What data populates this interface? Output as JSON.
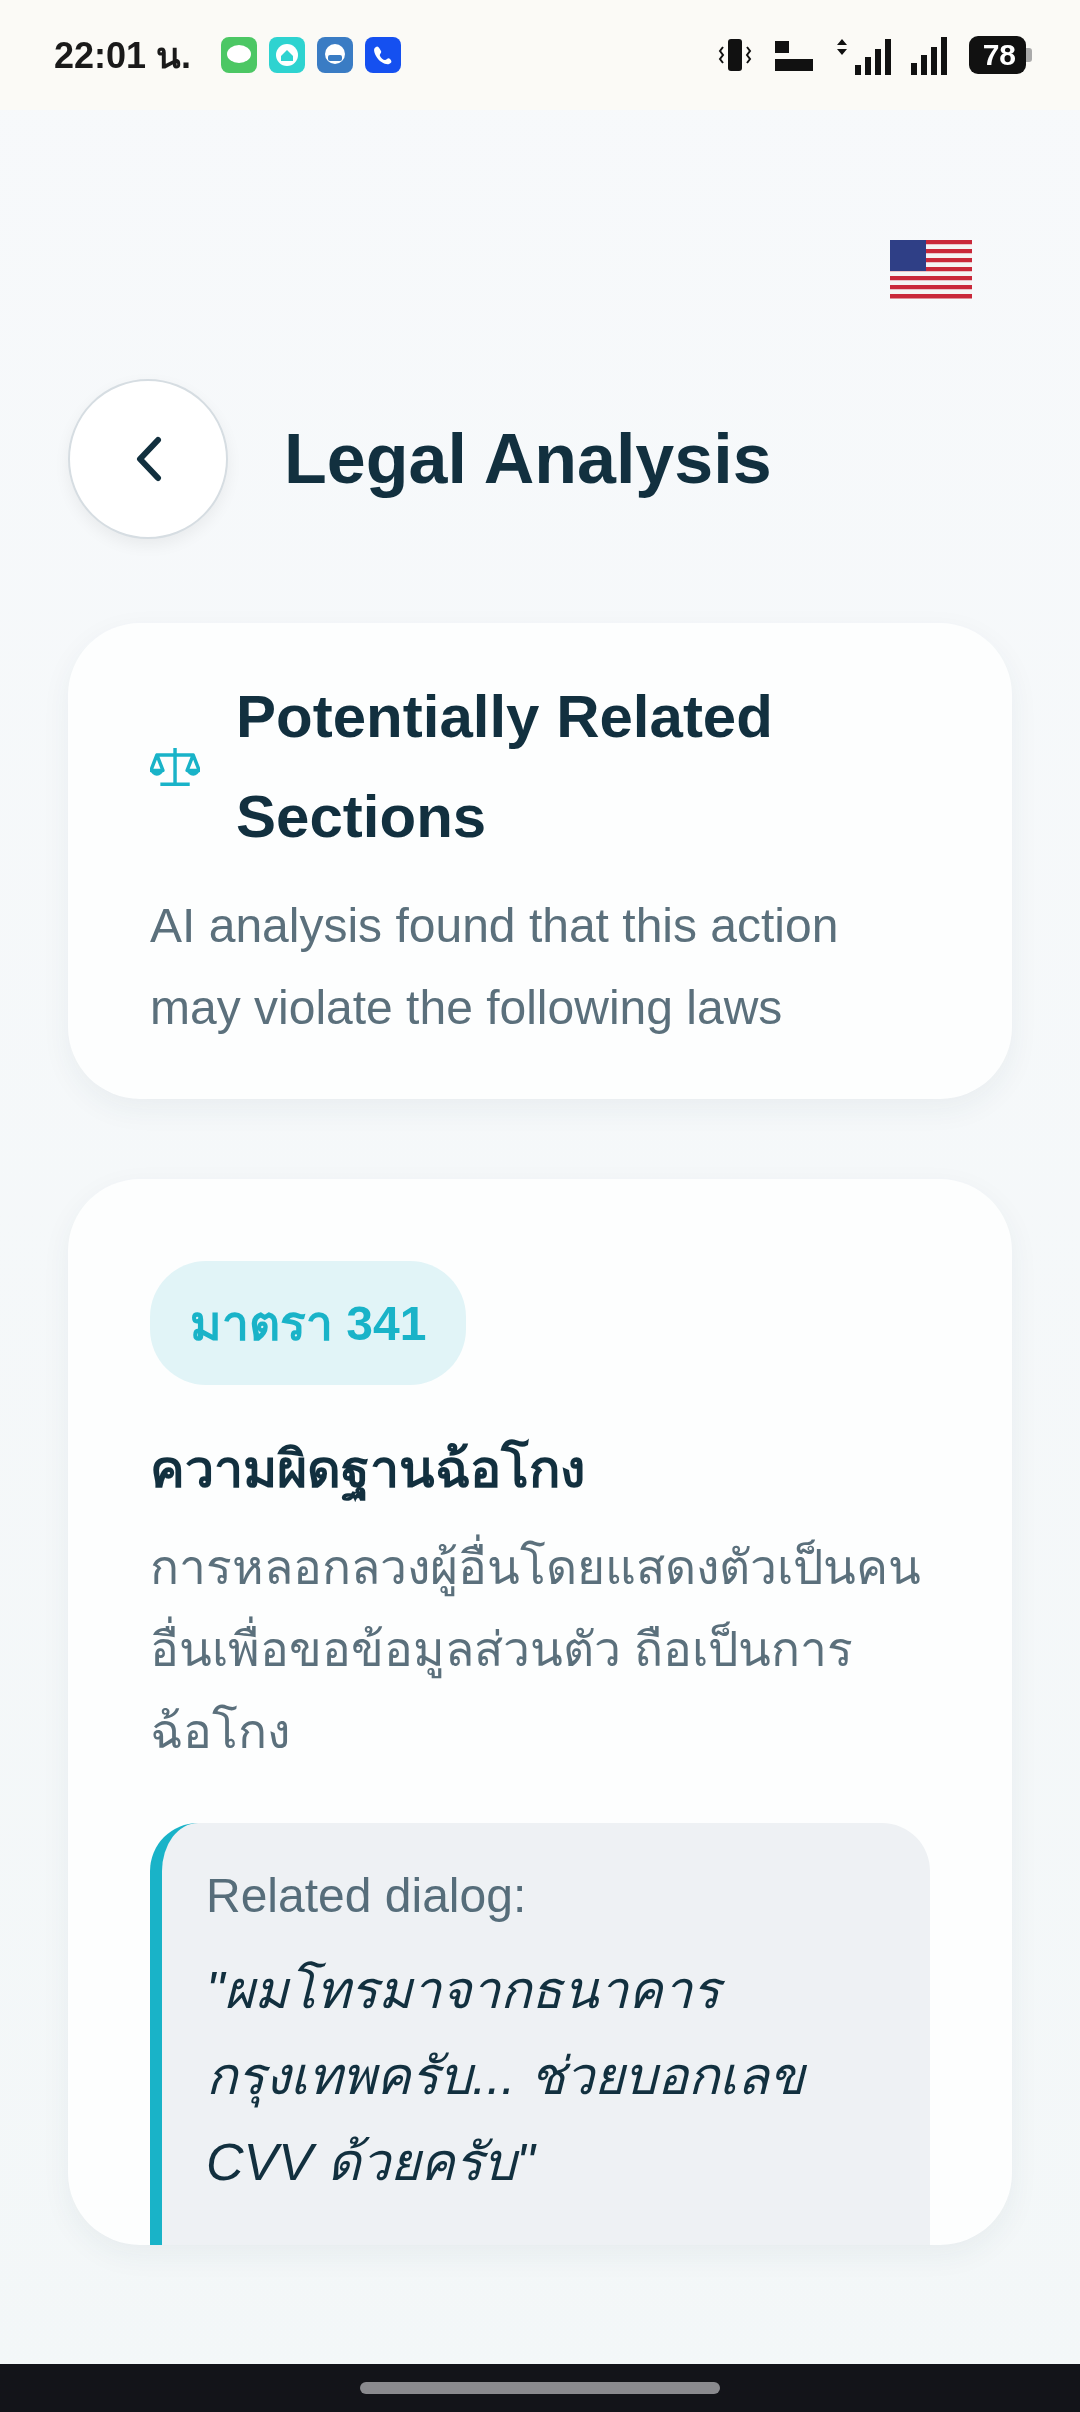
{
  "status_bar": {
    "time": "22:01 น.",
    "battery": "78"
  },
  "header": {
    "title": "Legal Analysis"
  },
  "summary": {
    "title": "Potentially Related Sections",
    "description": "AI analysis found that this action may violate the following laws"
  },
  "sections": [
    {
      "badge": "มาตรา 341",
      "title": "ความผิดฐานฉ้อโกง",
      "description": "การหลอกลวงผู้อื่นโดยแสดงตัวเป็นคนอื่นเพื่อขอข้อมูลส่วนตัว ถือเป็นการฉ้อโกง",
      "dialog_label": "Related dialog:",
      "dialog_quote": "\"ผมโทรมาจากธนาคารกรุงเทพครับ... ช่วยบอกเลข CVV ด้วยครับ\""
    }
  ]
}
